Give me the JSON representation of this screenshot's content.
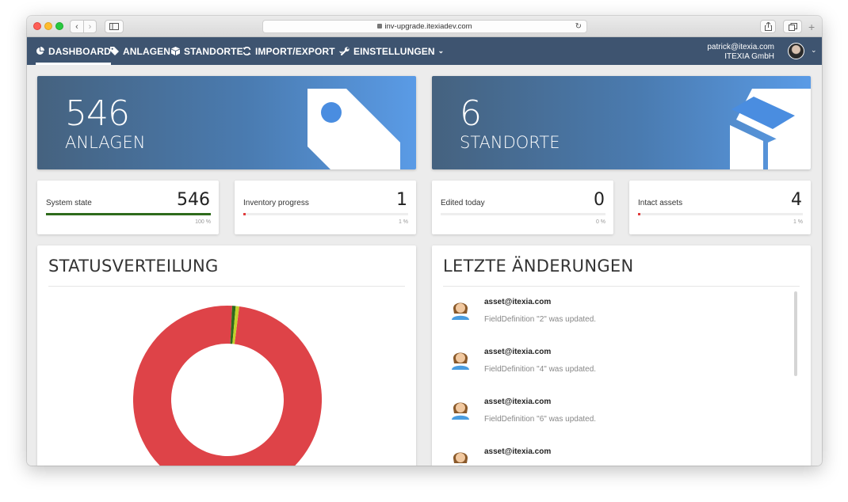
{
  "browser": {
    "url": "inv-upgrade.itexiadev.com"
  },
  "nav": {
    "items": [
      {
        "label": "DASHBOARD",
        "icon": "pie-chart-icon",
        "active": true
      },
      {
        "label": "ANLAGEN",
        "icon": "tag-icon"
      },
      {
        "label": "STANDORTE",
        "icon": "cube-icon"
      },
      {
        "label": "IMPORT/EXPORT",
        "icon": "sync-icon",
        "dropdown": true
      },
      {
        "label": "EINSTELLUNGEN",
        "icon": "wrench-icon",
        "dropdown": true
      }
    ],
    "user_email": "patrick@itexia.com",
    "user_company": "ITEXIA GmbH"
  },
  "hero": [
    {
      "value": "546",
      "label": "ANLAGEN",
      "icon": "tag-icon"
    },
    {
      "value": "6",
      "label": "STANDORTE",
      "icon": "cube-icon"
    }
  ],
  "stats": [
    {
      "label": "System state",
      "value": "546",
      "percent_text": "100 %",
      "progress": 1.0,
      "color": "#2e6b1c"
    },
    {
      "label": "Inventory progress",
      "value": "1",
      "percent_text": "1 %",
      "progress": 0.01,
      "color": "#e03c3c"
    },
    {
      "label": "Edited today",
      "value": "0",
      "percent_text": "0 %",
      "progress": 0.0,
      "color": "#e03c3c"
    },
    {
      "label": "Intact assets",
      "value": "4",
      "percent_text": "1 %",
      "progress": 0.01,
      "color": "#e03c3c"
    }
  ],
  "status_panel": {
    "title": "STATUSVERTEILUNG",
    "chart_data": {
      "type": "pie",
      "slices": [
        {
          "value": 0.988,
          "color": "#de4348"
        },
        {
          "value": 0.006,
          "color": "#2e6b1c"
        },
        {
          "value": 0.006,
          "color": "#c3d12a"
        }
      ]
    }
  },
  "changes_panel": {
    "title": "LETZTE ÄNDERUNGEN",
    "items": [
      {
        "user": "asset@itexia.com",
        "message": "FieldDefinition \"2\" was updated."
      },
      {
        "user": "asset@itexia.com",
        "message": "FieldDefinition \"4\" was updated."
      },
      {
        "user": "asset@itexia.com",
        "message": "FieldDefinition \"6\" was updated."
      },
      {
        "user": "asset@itexia.com",
        "message": ""
      }
    ]
  }
}
